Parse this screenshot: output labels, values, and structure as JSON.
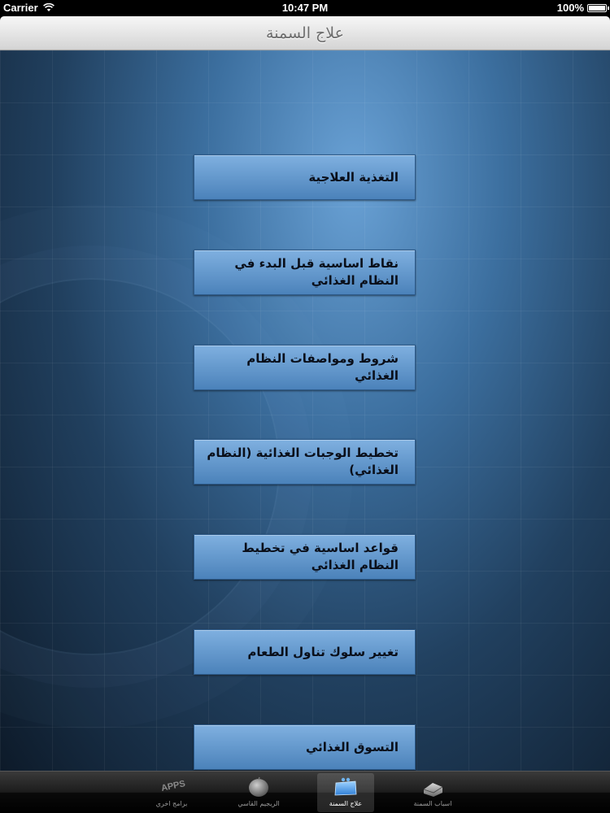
{
  "status_bar": {
    "carrier": "Carrier",
    "time": "10:47 PM",
    "battery": "100%"
  },
  "nav": {
    "title": "علاج السمنة"
  },
  "menu": {
    "items": [
      {
        "label": "التغذية العلاجية"
      },
      {
        "label": "نقاط اساسية قبل البدء في النظام الغذائي"
      },
      {
        "label": "شروط ومواصفات النظام الغذائي"
      },
      {
        "label": "تخطيط الوجبات الغذائية (النظام الغذائي)"
      },
      {
        "label": "قواعد اساسية في تخطيط النظام الغذائي"
      },
      {
        "label": "تغيير سلوك تناول الطعام"
      },
      {
        "label": "التسوق الغذائي"
      }
    ]
  },
  "tab_bar": {
    "tabs": [
      {
        "label": "برامج اخري",
        "icon": "apps-icon",
        "icon_text": "APPS",
        "selected": false
      },
      {
        "label": "الريجيم القاسي",
        "icon": "apple-icon",
        "selected": false
      },
      {
        "label": "علاج السمنة",
        "icon": "scale-icon",
        "selected": true
      },
      {
        "label": "اسباب السمنة",
        "icon": "cake-icon",
        "selected": false
      }
    ]
  },
  "colors": {
    "button_top": "#7fb0e0",
    "button_bottom": "#4b82ba",
    "background_center": "#6aa2d6",
    "background_edge": "#0d1a29"
  }
}
